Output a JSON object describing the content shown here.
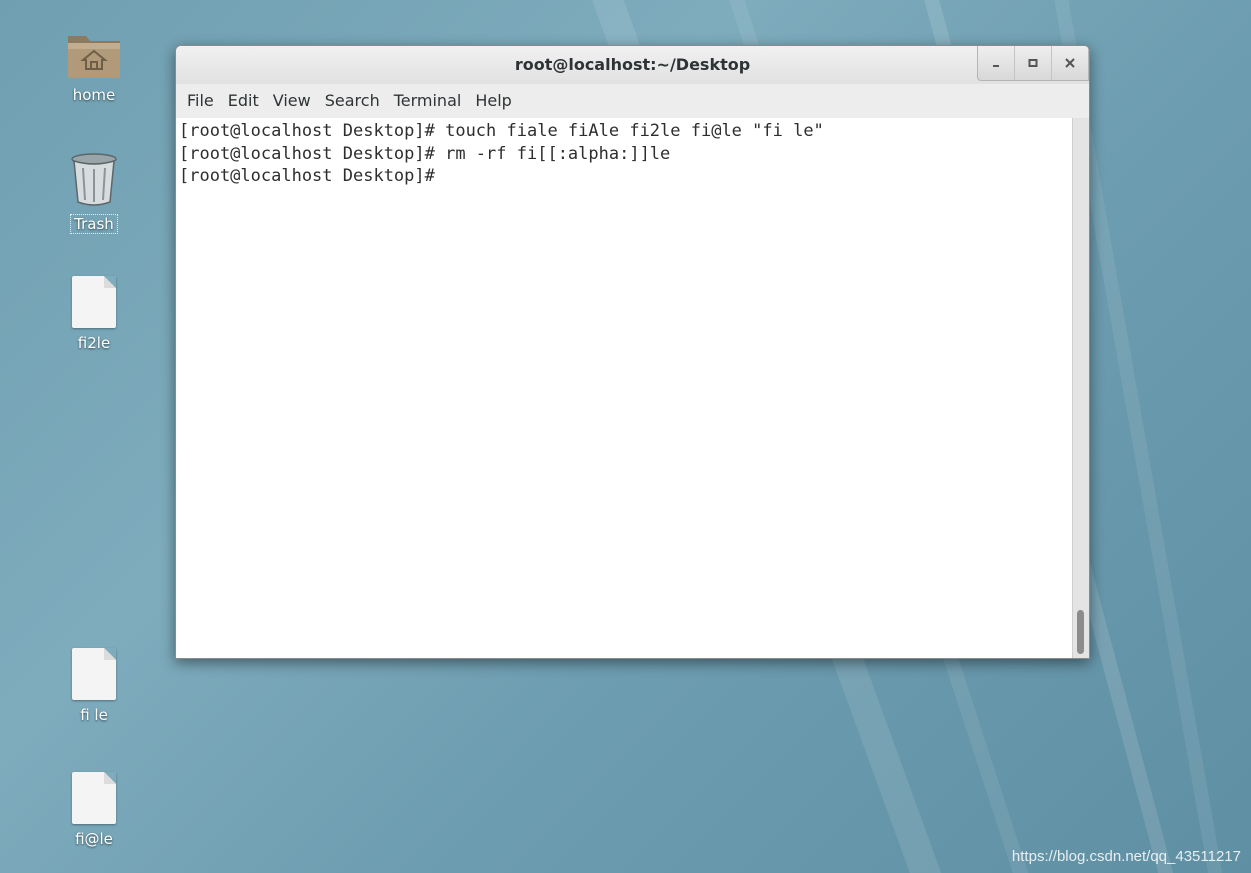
{
  "desktop": {
    "icons": [
      {
        "label": "home",
        "icon": "home-folder-icon"
      },
      {
        "label": "Trash",
        "icon": "trash-icon"
      },
      {
        "label": "fi2le",
        "icon": "document-icon"
      },
      {
        "label": "fi le",
        "icon": "document-icon"
      },
      {
        "label": "fi@le",
        "icon": "document-icon"
      }
    ],
    "watermark": "https://blog.csdn.net/qq_43511217"
  },
  "window": {
    "title": "root@localhost:~/Desktop",
    "controls": [
      "minimize-icon",
      "maximize-icon",
      "close-icon"
    ]
  },
  "menubar": {
    "items": [
      "File",
      "Edit",
      "View",
      "Search",
      "Terminal",
      "Help"
    ]
  },
  "terminal": {
    "lines": [
      "[root@localhost Desktop]# touch fiale fiAle fi2le fi@le \"fi le\"",
      "[root@localhost Desktop]# rm -rf fi[[:alpha:]]le",
      "[root@localhost Desktop]# "
    ]
  },
  "colors": {
    "desktop_bg": "#7eacbd",
    "titlebar_bg": "#e8e8e8",
    "terminal_bg": "#ffffff",
    "terminal_fg": "#2e2e2e"
  }
}
